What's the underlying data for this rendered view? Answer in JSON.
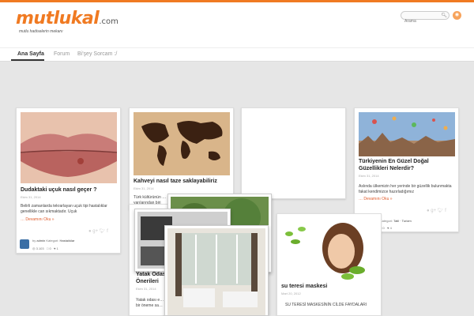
{
  "header": {
    "logo": "mutlukal",
    "logo_suffix": ".com",
    "tagline": "mutlu hadiselerin mekanı",
    "search_placeholder": "Arama"
  },
  "nav": {
    "items": [
      "Ana Sayfa",
      "Forum",
      "Bi'şey Sorcam :/"
    ]
  },
  "posts": [
    {
      "title": "Dudaktaki uçuk nasıl geçer ?",
      "date": "Ekim 31, 2014",
      "excerpt": "Belirli zamanlarda tekrarlayan uçuk tipi hastalıklar genellikle can sıkmaktadır. Uçuk",
      "more": "… Devamını Oku »",
      "author": "admin",
      "category_label": "Kategori:",
      "category": "Hastalıklar",
      "views": "3.103",
      "comments": "0",
      "likes": "1"
    },
    {
      "title": "Kahveyi nasıl taze saklayabiliriz",
      "date": "Ekim 31, 2014",
      "excerpt": "Türk kültürünün … yarılarından biri"
    },
    {
      "title": "Türkiyenin En Güzel Doğal Güzellikleri Nelerdir?",
      "date": "Ekim 31, 2014",
      "excerpt": "Aslında ülkemizin her yerinde bir güzellik bulunmakta fakat kendimizce hazırladığımız",
      "more": "… Devamını Oku »",
      "category_label": "Kategori:",
      "category": "Tatil · Turizm",
      "comments": "0",
      "likes": "4"
    },
    {
      "title": "Yatak Odası Önerileri",
      "date": "Ekim 31, 2014",
      "excerpt": "Yatak odası e… bir öneme sa…"
    },
    {
      "title": "su teresi maskesi",
      "date": "Mart 20, 2012",
      "excerpt": "SU TERESİ MASKESİNİN CİLDE FAYDALARI"
    }
  ]
}
